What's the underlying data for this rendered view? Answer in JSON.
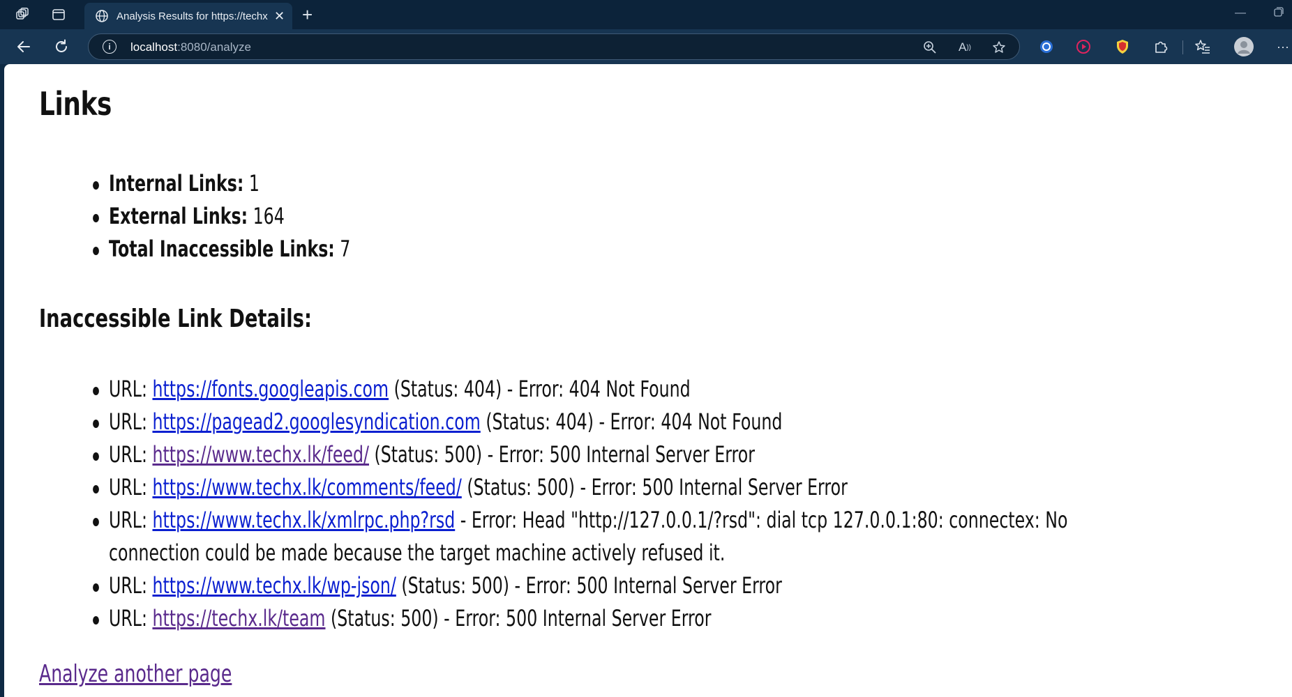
{
  "browser": {
    "tab_title": "Analysis Results for https://techx.lk",
    "url_host": "localhost",
    "url_rest": ":8080/analyze"
  },
  "page": {
    "title": "Links",
    "stats": [
      {
        "label": "Internal Links:",
        "value": "1"
      },
      {
        "label": "External Links:",
        "value": "164"
      },
      {
        "label": "Total Inaccessible Links:",
        "value": "7"
      }
    ],
    "details_title": "Inaccessible Link Details:",
    "url_prefix": "URL:",
    "errors": [
      {
        "url": "https://fonts.googleapis.com",
        "detail": "(Status: 404) - Error: 404 Not Found",
        "visited": false
      },
      {
        "url": "https://pagead2.googlesyndication.com",
        "detail": "(Status: 404) - Error: 404 Not Found",
        "visited": false
      },
      {
        "url": "https://www.techx.lk/feed/",
        "detail": "(Status: 500) - Error: 500 Internal Server Error",
        "visited": true
      },
      {
        "url": "https://www.techx.lk/comments/feed/",
        "detail": "(Status: 500) - Error: 500 Internal Server Error",
        "visited": false
      },
      {
        "url": "https://www.techx.lk/xmlrpc.php?rsd",
        "detail": "- Error: Head \"http://127.0.0.1/?rsd\": dial tcp 127.0.0.1:80: connectex: No connection could be made because the target machine actively refused it.",
        "visited": false
      },
      {
        "url": "https://www.techx.lk/wp-json/",
        "detail": "(Status: 500) - Error: 500 Internal Server Error",
        "visited": false
      },
      {
        "url": "https://techx.lk/team",
        "detail": "(Status: 500) - Error: 500 Internal Server Error",
        "visited": true
      }
    ],
    "analyze_another_label": "Analyze another page"
  },
  "icons": {
    "workspaces": "workspaces-icon",
    "tab_actions": "tab-actions-icon",
    "globe": "globe-icon",
    "close": "close-icon",
    "new_tab": "plus-icon",
    "back": "back-arrow-icon",
    "refresh": "refresh-icon",
    "info": "info-icon",
    "zoom": "zoom-icon",
    "read_aloud": "read-aloud-icon",
    "favorite": "star-icon",
    "favorites": "favorites-icon",
    "extensions": "puzzle-icon",
    "more": "more-icon"
  }
}
